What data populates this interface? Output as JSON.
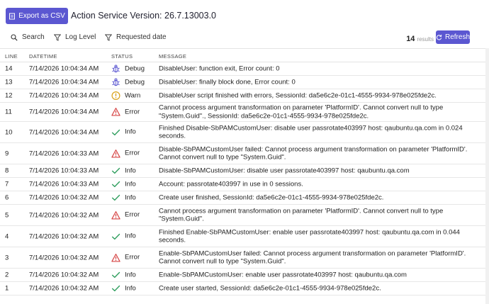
{
  "header": {
    "export_label": "Export as CSV",
    "version_label": "Action Service Version: 26.7.13003.0"
  },
  "filters": {
    "search_label": "Search",
    "log_level_label": "Log Level",
    "requested_date_label": "Requested date",
    "result_count": "14",
    "results_label": "results",
    "refresh_label": "Refresh"
  },
  "columns": {
    "line": "LINE",
    "datetime": "DATETIME",
    "status": "STATUS",
    "message": "MESSAGE"
  },
  "status_colors": {
    "debug": "#5b57d1",
    "warn": "#d9a21b",
    "error": "#d64545",
    "info": "#2f9e5e"
  },
  "rows": [
    {
      "line": "14",
      "datetime": "7/14/2026 10:04:34 AM",
      "status": "Debug",
      "icon": "bug-icon",
      "message": "DisableUser: function exit, Error count: 0"
    },
    {
      "line": "13",
      "datetime": "7/14/2026 10:04:34 AM",
      "status": "Debug",
      "icon": "bug-icon",
      "message": "DisableUser: finally block done, Error count: 0"
    },
    {
      "line": "12",
      "datetime": "7/14/2026 10:04:34 AM",
      "status": "Warn",
      "icon": "warning-circle-icon",
      "message": "DisableUser script finished with errors, SessionId: da5e6c2e-01c1-4555-9934-978e025fde2c."
    },
    {
      "line": "11",
      "datetime": "7/14/2026 10:04:34 AM",
      "status": "Error",
      "icon": "error-triangle-icon",
      "message": "Cannot process argument transformation on parameter 'PlatformID'. Cannot convert null to type \"System.Guid\"., SessionId: da5e6c2e-01c1-4555-9934-978e025fde2c."
    },
    {
      "line": "10",
      "datetime": "7/14/2026 10:04:34 AM",
      "status": "Info",
      "icon": "check-icon",
      "message": "Finished Disable-SbPAMCustomUser: disable user passrotate403997 host: qaubuntu.qa.com in 0.024 seconds."
    },
    {
      "line": "9",
      "datetime": "7/14/2026 10:04:33 AM",
      "status": "Error",
      "icon": "error-triangle-icon",
      "message": "Disable-SbPAMCustomUser failed: Cannot process argument transformation on parameter 'PlatformID'. Cannot convert null to type \"System.Guid\"."
    },
    {
      "line": "8",
      "datetime": "7/14/2026 10:04:33 AM",
      "status": "Info",
      "icon": "check-icon",
      "message": "Disable-SbPAMCustomUser: disable user passrotate403997 host: qaubuntu.qa.com"
    },
    {
      "line": "7",
      "datetime": "7/14/2026 10:04:33 AM",
      "status": "Info",
      "icon": "check-icon",
      "message": "Account: passrotate403997 in use in 0 sessions."
    },
    {
      "line": "6",
      "datetime": "7/14/2026 10:04:32 AM",
      "status": "Info",
      "icon": "check-icon",
      "message": "Create user finished, SessionId: da5e6c2e-01c1-4555-9934-978e025fde2c."
    },
    {
      "line": "5",
      "datetime": "7/14/2026 10:04:32 AM",
      "status": "Error",
      "icon": "error-triangle-icon",
      "message": "Cannot process argument transformation on parameter 'PlatformID'. Cannot convert null to type \"System.Guid\"."
    },
    {
      "line": "4",
      "datetime": "7/14/2026 10:04:32 AM",
      "status": "Info",
      "icon": "check-icon",
      "message": "Finished Enable-SbPAMCustomUser: enable user passrotate403997 host: qaubuntu.qa.com in 0.044 seconds."
    },
    {
      "line": "3",
      "datetime": "7/14/2026 10:04:32 AM",
      "status": "Error",
      "icon": "error-triangle-icon",
      "message": "Enable-SbPAMCustomUser failed: Cannot process argument transformation on parameter 'PlatformID'. Cannot convert null to type \"System.Guid\"."
    },
    {
      "line": "2",
      "datetime": "7/14/2026 10:04:32 AM",
      "status": "Info",
      "icon": "check-icon",
      "message": "Enable-SbPAMCustomUser: enable user passrotate403997 host: qaubuntu.qa.com"
    },
    {
      "line": "1",
      "datetime": "7/14/2026 10:04:32 AM",
      "status": "Info",
      "icon": "check-icon",
      "message": "Create user started, SessionId: da5e6c2e-01c1-4555-9934-978e025fde2c."
    }
  ]
}
